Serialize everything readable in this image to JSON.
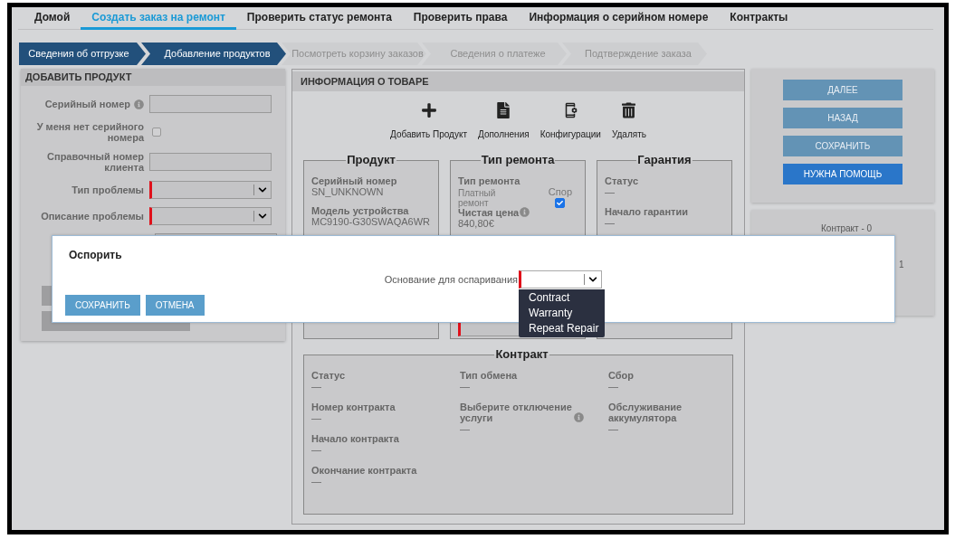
{
  "nav": {
    "tabs": [
      {
        "label": "Домой",
        "selected": false
      },
      {
        "label": "Создать заказ на ремонт",
        "selected": true
      },
      {
        "label": "Проверить статус ремонта",
        "selected": false
      },
      {
        "label": "Проверить права",
        "selected": false
      },
      {
        "label": "Информация о серийном номере",
        "selected": false
      },
      {
        "label": "Контракты",
        "selected": false
      }
    ]
  },
  "steps": [
    {
      "label": "Сведения об отгрузке",
      "reached": true
    },
    {
      "label": "Добавление продуктов",
      "reached": true
    },
    {
      "label": "Посмотреть корзину заказов",
      "reached": false
    },
    {
      "label": "Сведения о платеже",
      "reached": false
    },
    {
      "label": "Подтверждение заказа",
      "reached": false
    }
  ],
  "add_product": {
    "title": "ДОБАВИТЬ ПРОДУКТ",
    "fields": [
      {
        "kind": "input",
        "label": "Серийный номер",
        "info": true,
        "required": false
      },
      {
        "kind": "checkbox",
        "label": "У меня нет серийного номера",
        "info": false,
        "checked": false
      },
      {
        "kind": "input",
        "label": "Справочный номер клиента",
        "info": false,
        "required": false
      },
      {
        "kind": "select",
        "label": "Тип проблемы",
        "info": false,
        "required": true
      },
      {
        "kind": "select",
        "label": "Описание проблемы",
        "info": false,
        "required": true
      }
    ]
  },
  "product_info": {
    "title": "ИНФОРМАЦИЯ О ТОВАРЕ",
    "actions": [
      {
        "kind": "add",
        "label": "Добавить Продукт"
      },
      {
        "kind": "document",
        "label": "Дополнения"
      },
      {
        "kind": "config",
        "label": "Конфигурации"
      },
      {
        "kind": "delete",
        "label": "Удалять"
      }
    ],
    "product": {
      "title": "Продукт",
      "items": [
        {
          "label": "Серийный номер",
          "value": "SN_UNKNOWN"
        },
        {
          "label": "Модель устройства",
          "value": "MC9190-G30SWAQA6WR"
        }
      ]
    },
    "repair_type": {
      "title": "Тип ремонта",
      "label": "Тип ремонта",
      "value": "Платный ремонт",
      "dispute_label": "Спор",
      "dispute_checked": true,
      "price_label": "Чистая цена",
      "price": "840,80€"
    },
    "warranty": {
      "title": "Гарантия",
      "items": [
        {
          "label": "Статус",
          "value": "—"
        },
        {
          "label": "Начало гарантии",
          "value": "—"
        }
      ]
    },
    "contract": {
      "title": "Контракт",
      "columns": [
        [
          {
            "label": "Статус",
            "value": "—",
            "info": false
          },
          {
            "label": "Номер контракта",
            "value": "—",
            "info": false
          },
          {
            "label": "Начало контракта",
            "value": "—",
            "info": false
          },
          {
            "label": "Окончание контракта",
            "value": "—",
            "info": false
          }
        ],
        [
          {
            "label": "Тип обмена",
            "value": "—",
            "info": false
          },
          {
            "label": "Выберите отключение услуги",
            "value": "—",
            "info": true
          }
        ],
        [
          {
            "label": "Сбор",
            "value": "—",
            "info": false
          },
          {
            "label": "Обслуживание аккумулятора",
            "value": "—",
            "info": false
          }
        ]
      ]
    }
  },
  "side": {
    "buttons": [
      {
        "label": "ДАЛЕЕ",
        "kind": "secondary"
      },
      {
        "label": "НАЗАД",
        "kind": "secondary"
      },
      {
        "label": "СОХРАНИТЬ",
        "kind": "secondary"
      },
      {
        "label": "НУЖНА ПОМОЩЬ",
        "kind": "primary"
      }
    ],
    "contract_card": {
      "title": "Контракт - 0",
      "count": "1"
    }
  },
  "dialog": {
    "title": "Оспорить",
    "field_label": "Основание для оспаривания",
    "required": true,
    "options": [
      "Contract",
      "Warranty",
      "Repeat Repair"
    ],
    "buttons": [
      {
        "label": "СОХРАНИТЬ"
      },
      {
        "label": "ОТМЕНА"
      }
    ]
  }
}
